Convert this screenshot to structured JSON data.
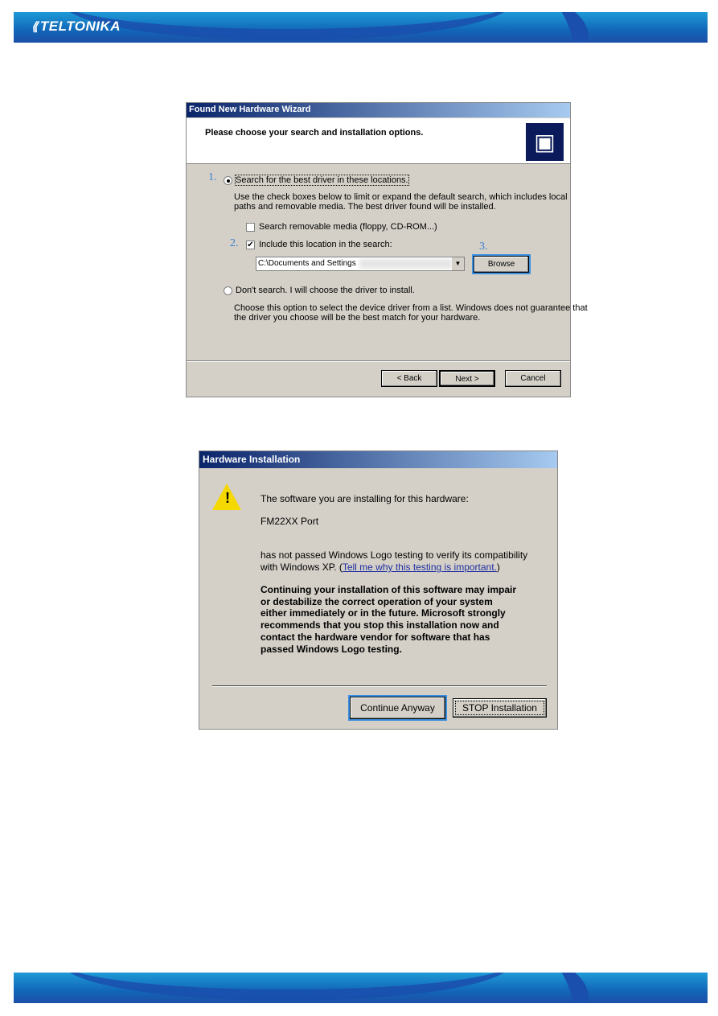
{
  "brand": {
    "logo": "TELTONIKA"
  },
  "wizard": {
    "title": "Found New Hardware Wizard",
    "heading": "Please choose your search and installation options.",
    "option_search": "Search for the best driver in these locations.",
    "search_desc_1": "Use the check boxes below to limit or expand the default search, which includes local",
    "search_desc_2": "paths and removable media. The best driver found will be installed.",
    "removable_label": "Search removable media (floppy, CD-ROM...)",
    "removable_checked": false,
    "include_label": "Include this location in the search:",
    "include_checked": true,
    "path_value": "C:\\Documents and Settings",
    "browse": "Browse",
    "option_dont": "Don't search. I will choose the driver to install.",
    "dont_desc_1": "Choose this option to select the device driver from a list.  Windows does not guarantee that",
    "dont_desc_2": "the driver you choose will be the best match for your hardware.",
    "back": "< Back",
    "next": "Next >",
    "cancel": "Cancel",
    "steps": [
      "1.",
      "2.",
      "3."
    ]
  },
  "hwinstall": {
    "title": "Hardware Installation",
    "line1": "The software you are installing for this hardware:",
    "device": "FM22XX Port",
    "line2": "has not passed Windows Logo testing to verify its compatibility",
    "line3": "with Windows XP. (",
    "link": "Tell me why this testing is important.",
    "line3_end": ")",
    "warning": [
      "Continuing your installation of this software may impair",
      "or destabilize the correct operation of your system",
      "either immediately or in the future. Microsoft strongly",
      "recommends that you stop this installation now and",
      "contact the hardware vendor for software that has",
      "passed Windows Logo testing."
    ],
    "continue": "Continue Anyway",
    "stop": "STOP Installation"
  }
}
